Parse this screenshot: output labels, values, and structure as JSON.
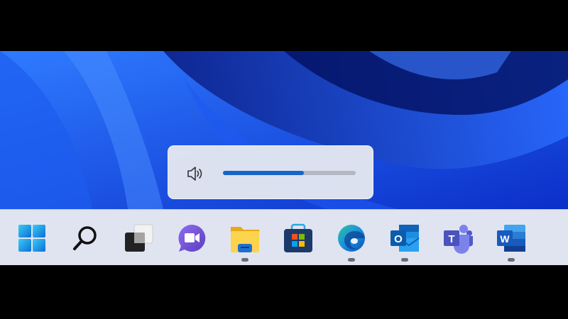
{
  "volume_flyout": {
    "icon": "speaker-icon",
    "level": 0.61,
    "accent": "#1766c6"
  },
  "taskbar": {
    "items": [
      {
        "name": "start",
        "icon": "windows-logo-icon",
        "running": false
      },
      {
        "name": "search",
        "icon": "search-icon",
        "running": false
      },
      {
        "name": "task-view",
        "icon": "task-view-icon",
        "running": false
      },
      {
        "name": "chat",
        "icon": "chat-video-icon",
        "running": false
      },
      {
        "name": "file-explorer",
        "icon": "folder-icon",
        "running": true
      },
      {
        "name": "microsoft-store",
        "icon": "store-bag-icon",
        "running": false
      },
      {
        "name": "edge",
        "icon": "edge-icon",
        "running": true
      },
      {
        "name": "outlook",
        "icon": "outlook-icon",
        "running": true,
        "letter": "O"
      },
      {
        "name": "teams",
        "icon": "teams-icon",
        "running": false,
        "letter": "T"
      },
      {
        "name": "word",
        "icon": "word-icon",
        "running": true,
        "letter": "W"
      }
    ]
  }
}
